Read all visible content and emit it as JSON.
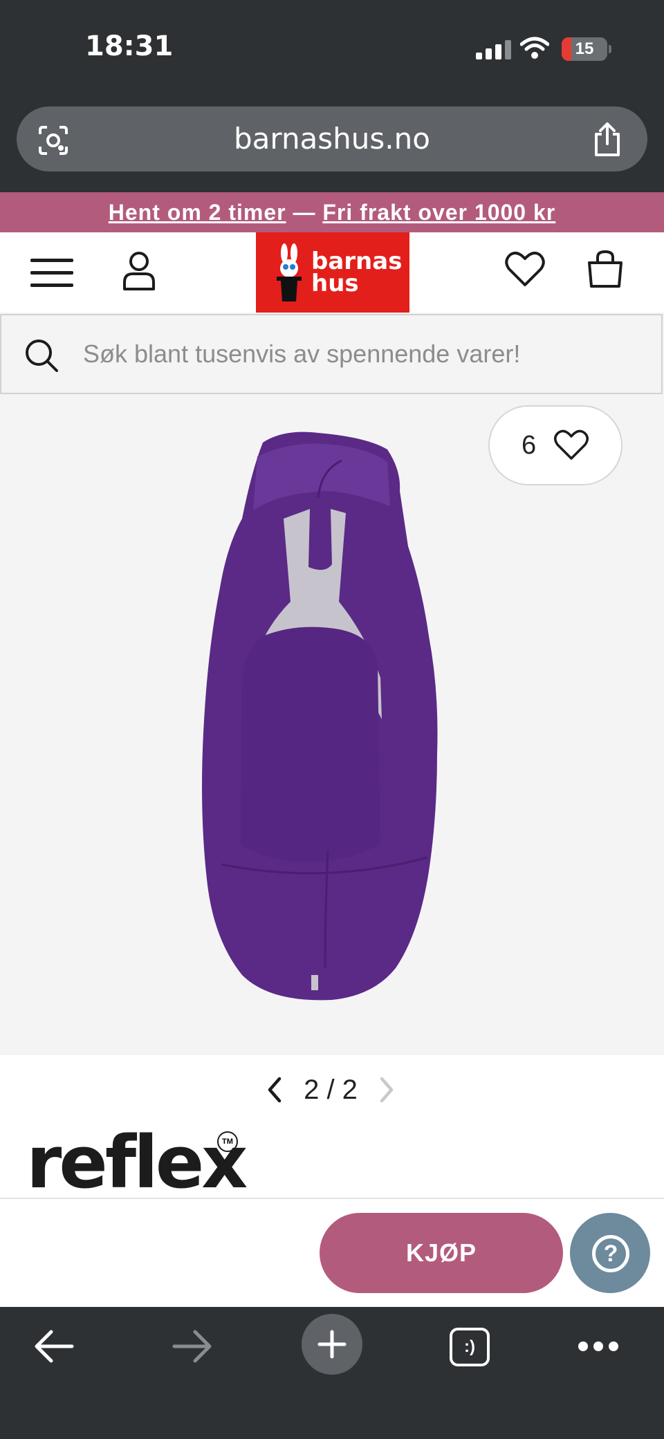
{
  "status_bar": {
    "time": "18:31",
    "battery": "15"
  },
  "browser": {
    "url": "barnashus.no"
  },
  "promo": {
    "part1": "Hent om 2 timer",
    "separator": " — ",
    "part2": "Fri frakt over 1000 kr"
  },
  "header": {
    "logo_line1": "barnas",
    "logo_line2": "hus"
  },
  "search": {
    "placeholder": "Søk blant tusenvis av spennende varer!"
  },
  "product": {
    "favorite_count": "6",
    "image_index": "2",
    "image_total": "2",
    "pager_text": "2 / 2",
    "brand": "reflex",
    "brand_mark": "TM"
  },
  "actions": {
    "buy_label": "KJØP",
    "help_label": "?"
  },
  "bottom_bar": {
    "tabs_label": ":)"
  },
  "colors": {
    "accent": "#b35b7d",
    "logo_red": "#e31f1b",
    "product_purple": "#5a2a86",
    "help_bg": "#6e8a9d",
    "chrome_bg": "#2e3134"
  }
}
